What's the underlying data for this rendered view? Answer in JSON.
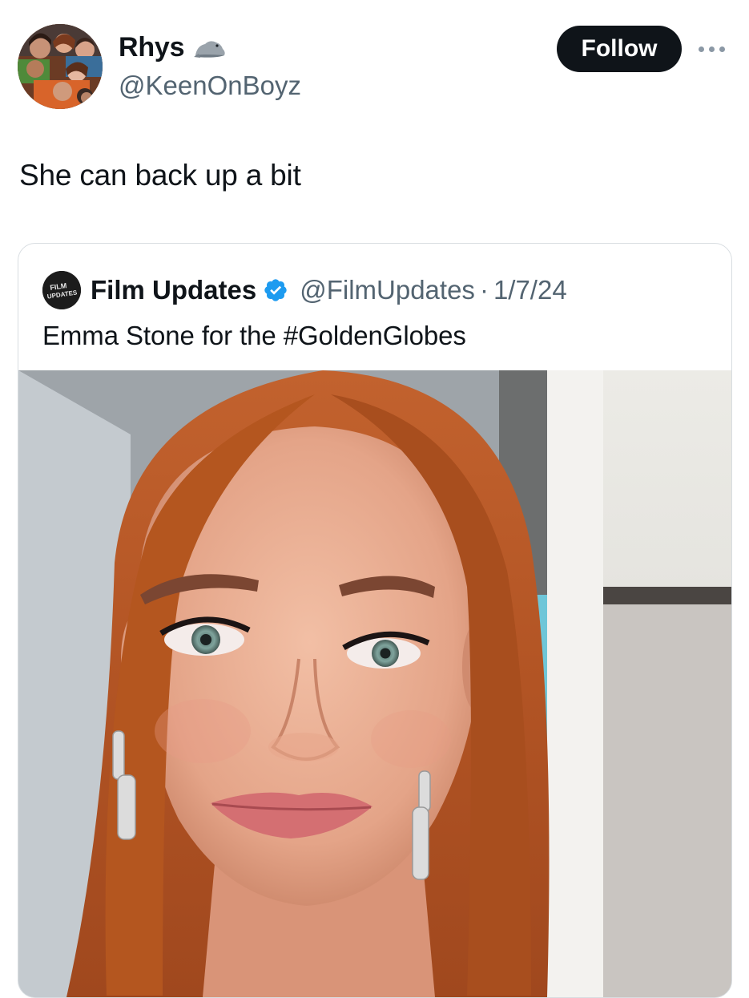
{
  "author": {
    "display_name": "Rhys",
    "handle": "@KeenOnBoyz",
    "name_emoji_icon": "seal-icon"
  },
  "actions": {
    "follow_label": "Follow",
    "more_icon": "more-horizontal-icon"
  },
  "tweet": {
    "text": "She can back up a bit"
  },
  "quoted_tweet": {
    "display_name": "Film Updates",
    "avatar_text": [
      "FILM",
      "UPDATES"
    ],
    "verified": true,
    "handle": "@FilmUpdates",
    "separator": "·",
    "date": "1/7/24",
    "text": "Emma Stone for the #GoldenGlobes"
  },
  "colors": {
    "follow_bg": "#0f1419",
    "secondary_text": "#536471",
    "verified_blue": "#1d9bf0"
  }
}
